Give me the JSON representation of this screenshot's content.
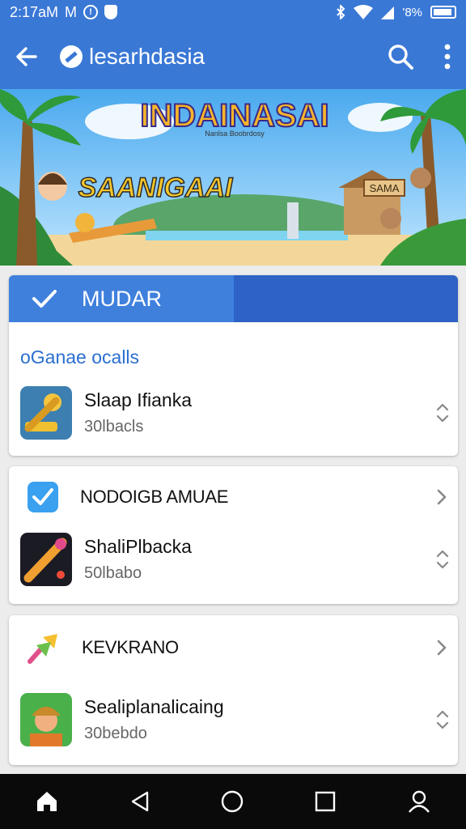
{
  "status_bar": {
    "time": "2:17aM",
    "carrier": "M",
    "battery": "'8%"
  },
  "app_bar": {
    "title": "lesarhdasia"
  },
  "banner": {
    "headline": "INDAINASAI",
    "tagline": "Nanlsa Boobrdosy",
    "subtitle": "SAANIGAAI",
    "hut_sign": "SAMA"
  },
  "tab": {
    "active_label": "MUDAR"
  },
  "section": {
    "title": "oGanae ocalls"
  },
  "items": [
    {
      "name": "Slaap Ifianka",
      "sub": "30lbacls"
    },
    {
      "name": "ShaliPlbacka",
      "sub": "50lbabo"
    },
    {
      "name": "Sealiplanalicaing",
      "sub": "30bebdo"
    }
  ],
  "groups": [
    {
      "label": "NODOIGB AMUAE"
    },
    {
      "label": "KEVKRANO"
    }
  ],
  "colors": {
    "primary": "#3a78d6",
    "tab_active": "#3f80dd",
    "tab_bg": "#2e62c4",
    "section_text": "#2a6fd0",
    "nav_bg": "#0a0a0a"
  },
  "icons": {
    "back": "arrow-left-icon",
    "search": "search-icon",
    "more": "more-vertical-icon",
    "check": "check-icon",
    "stepper": "up-down-icon",
    "chevron": "chevron-right-icon",
    "nav": [
      "home-icon",
      "back-triangle-icon",
      "circle-home-icon",
      "square-recents-icon",
      "person-icon"
    ]
  }
}
